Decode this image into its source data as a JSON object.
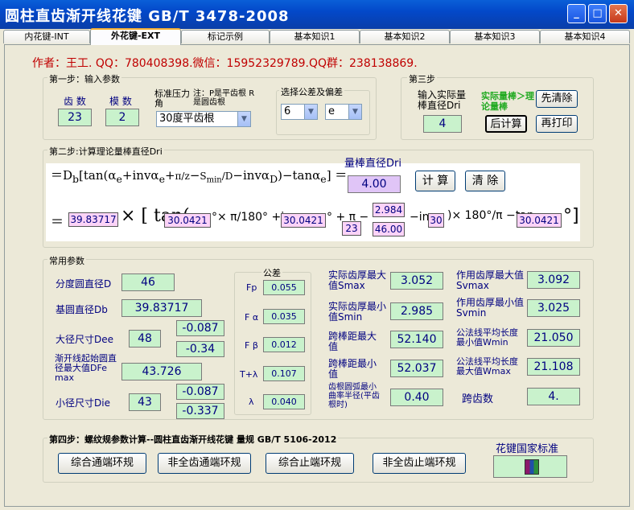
{
  "window": {
    "title": "圆柱直齿渐开线花键    GB/T 3478-2008",
    "min": "_",
    "max": "□",
    "close": "✕"
  },
  "tabs": [
    "内花键-INT",
    "外花键-EXT",
    "标记示例",
    "基本知识1",
    "基本知识2",
    "基本知识3",
    "基本知识4"
  ],
  "author": "作者：王工. QQ：780408398.微信：15952329789.QQ群：238138869.",
  "step1": {
    "title": "第一步：输入参数",
    "teeth_label": "齿 数",
    "teeth": "23",
    "module_label": "模 数",
    "module": "2",
    "std_label": "标准压力角",
    "note": "注：P是平齿根 R是圆齿根",
    "angle": "30度平齿根",
    "tol_title": "选择公差及偏差",
    "tol_grade": "6",
    "tol_dev": "e"
  },
  "step3": {
    "title": "第三步",
    "input_label": "输入实际量棒直径Dri",
    "value": "4",
    "hint": "实际量棒＞理论量棒",
    "clear": "先清除",
    "calc": "后计算",
    "reprint": "再打印"
  },
  "step2": {
    "title": "第二步:计算理论量棒直径Dri",
    "dri_label": "量棒直径Dri",
    "dri": "4.00",
    "calc": "计 算",
    "clear": "清 除",
    "f_db": "39.83717",
    "f_a1": "30.0421",
    "f_a2": "30.0421",
    "f_s": "2.984",
    "f_z": "23",
    "f_d": "46.00",
    "f_inv": "30",
    "f_a3": "30.0421"
  },
  "common": {
    "title": "常用参数",
    "d_label": "分度圆直径D",
    "d": "46",
    "db_label": "基圆直径Db",
    "db": "39.83717",
    "dee_label": "大径尺寸Dee",
    "dee": "48",
    "dee_up": "-0.087",
    "dee_lo": "-0.34",
    "dfe_label": "渐开线起始圆直径最大值DFe max",
    "dfe": "43.726",
    "die_label": "小径尺寸Die",
    "die": "43",
    "die_up": "-0.087",
    "die_lo": "-0.337",
    "tol_title": "公差",
    "fp_label": "Fp",
    "fp": "0.055",
    "fa_label": "F α",
    "fa": "0.035",
    "fb_label": "F β",
    "fb": "0.012",
    "tl_label": "T+λ",
    "tl": "0.107",
    "l_label": "λ",
    "l": "0.040",
    "smax_label": "实际齿厚最大值Smax",
    "smax": "3.052",
    "smin_label": "实际齿厚最小值Smin",
    "smin": "2.985",
    "mmax_label": "跨棒距最大值",
    "mmax": "52.140",
    "mmin_label": "跨棒距最小值",
    "mmin": "52.037",
    "rr_label": "齿根圆弧最小曲率半径(平齿根时)",
    "rr": "0.40",
    "svmax_label": "作用齿厚最大值Svmax",
    "svmax": "3.092",
    "svmin_label": "作用齿厚最小值Svmin",
    "svmin": "3.025",
    "wmin_label": "公法线平均长度最小值Wmin",
    "wmin": "21.050",
    "wmax_label": "公法线平均长度最大值Wmax",
    "wmax": "21.108",
    "k_label": "跨齿数",
    "k": "4."
  },
  "step4": {
    "title": "第四步：螺纹规参数计算--圆柱直齿渐开线花键 量规   GB/T 5106-2012",
    "b1": "综合通端环规",
    "b2": "非全齿通端环规",
    "b3": "综合止端环规",
    "b4": "非全齿止端环规",
    "std": "花键国家标准"
  },
  "colors": {
    "title_bar": "#0348c9",
    "field": "#c9f2cc",
    "pink": "#fcd3f7",
    "author": "#c00000",
    "hint": "#22aa22"
  }
}
